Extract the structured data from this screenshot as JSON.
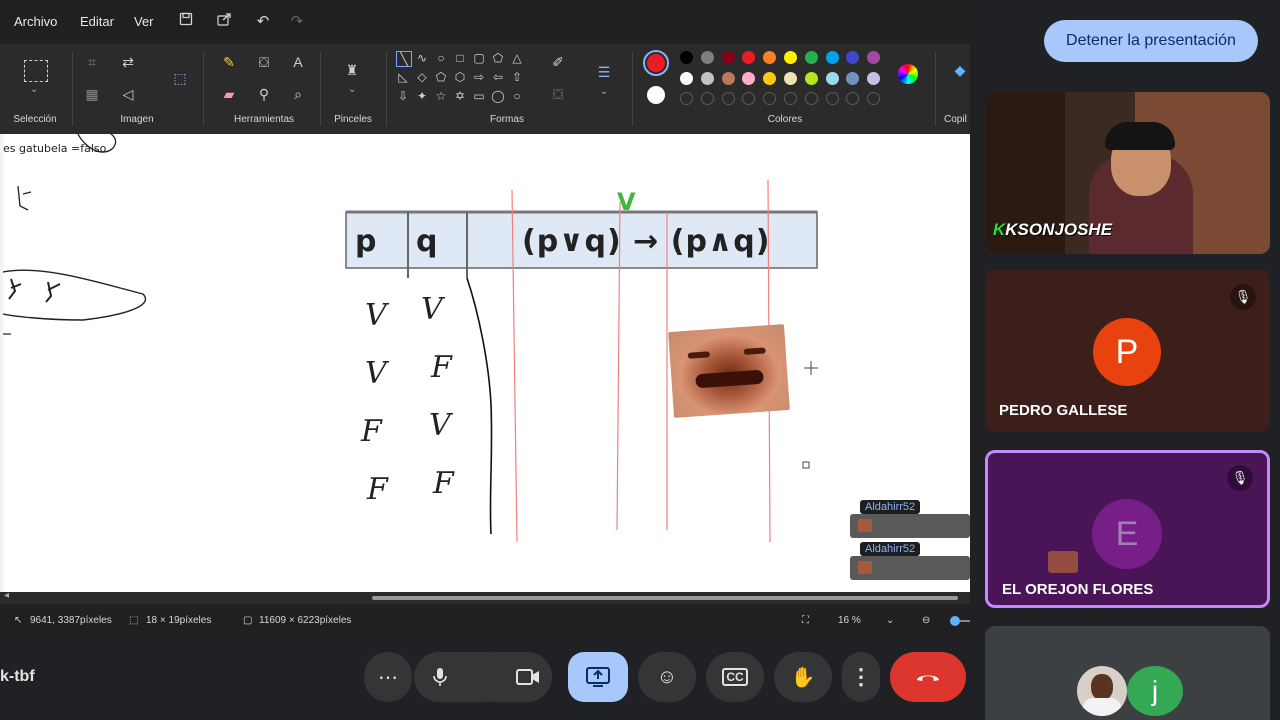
{
  "paint": {
    "menu": {
      "file": "Archivo",
      "edit": "Editar",
      "view": "Ver"
    },
    "groups": {
      "selection": "Selección",
      "image": "Imagen",
      "tools": "Herramientas",
      "brushes": "Pinceles",
      "shapes": "Formas",
      "colors": "Colores",
      "copilot": "Copil"
    },
    "palette_row1": [
      "#000000",
      "#7f7f7f",
      "#880015",
      "#ed1c24",
      "#ff7f27",
      "#fff200",
      "#22b14c",
      "#00a2e8",
      "#3f48cc",
      "#a349a4"
    ],
    "palette_row2": [
      "#ffffff",
      "#c3c3c3",
      "#b97a57",
      "#ffaec9",
      "#ffc90e",
      "#efe4b0",
      "#b5e61d",
      "#99d9ea",
      "#7092be",
      "#c8bfe7"
    ],
    "primary_color": "#ed1c24",
    "secondary_color": "#ffffff",
    "canvas": {
      "note": "es gatubela =falso",
      "table_headers": {
        "p": "p",
        "q": "q",
        "expr": "(p∨q) → (p∧q)"
      },
      "checkmark": "V",
      "col_p": [
        "V",
        "V",
        "F",
        "F"
      ],
      "col_q": [
        "V",
        "F",
        "V",
        "F"
      ]
    },
    "status": {
      "cursor_pos": "9641, 3387píxeles",
      "selection_size": "18 × 19píxeles",
      "canvas_size": "11609 × 6223píxeles",
      "zoom": "16 %"
    }
  },
  "meet": {
    "stop_presenting": "Detener la presentación",
    "meeting_code": "k-tbf",
    "participants": [
      {
        "name": "KSONJOSHE",
        "initial": ""
      },
      {
        "name": "PEDRO GALLESE",
        "initial": "P",
        "color": "#e8430e"
      },
      {
        "name": "EL OREJON FLORES",
        "initial": "E",
        "color": "#9c27b0"
      },
      {
        "name": "",
        "initial": "j",
        "color": "#34a853"
      }
    ],
    "chat": [
      {
        "user": "Aldahirr52"
      },
      {
        "user": "Aldahirr52"
      }
    ],
    "end_call_color": "#dc362e",
    "present_active_color": "#a8c7fa"
  }
}
